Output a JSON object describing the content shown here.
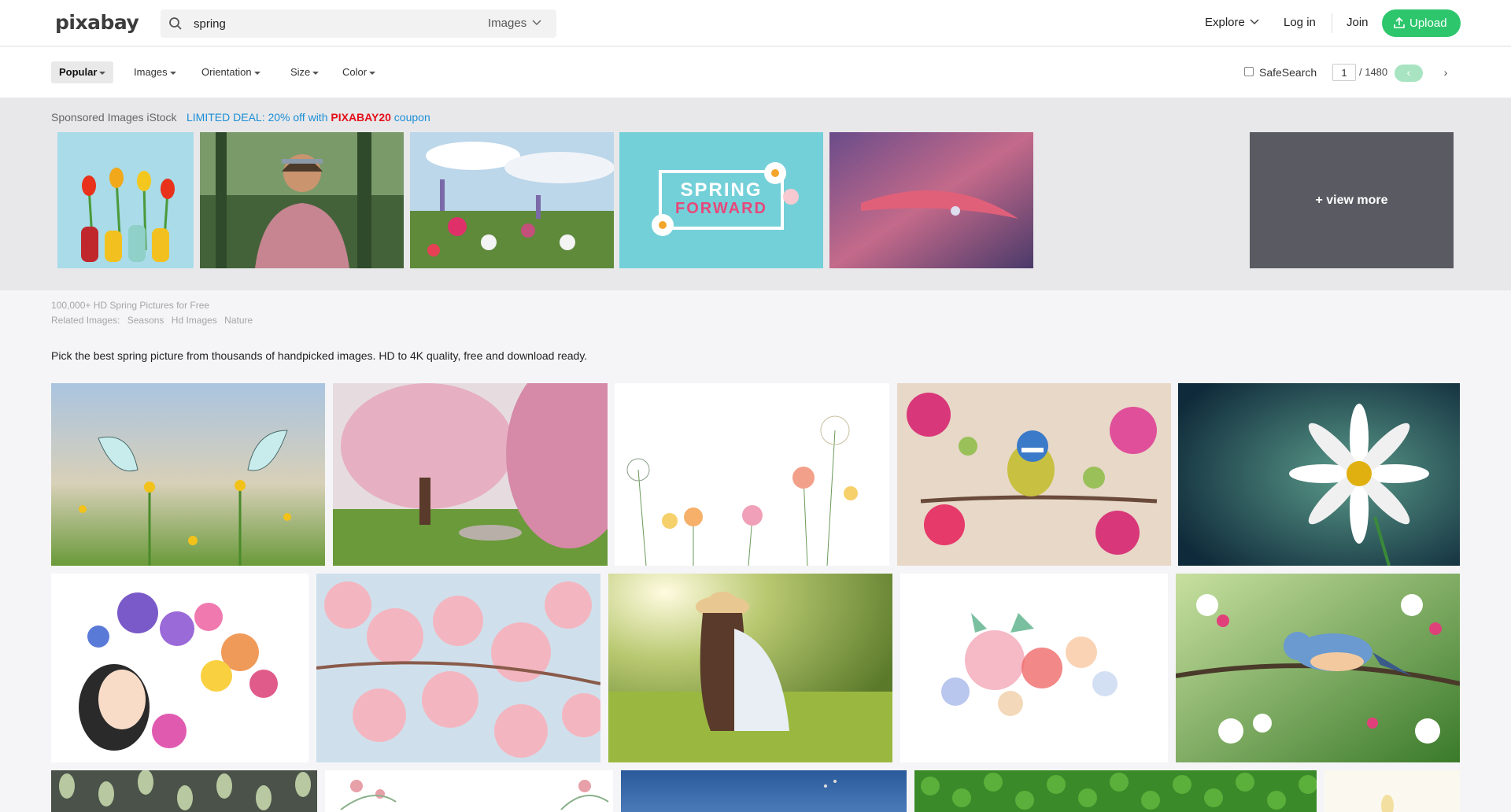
{
  "header": {
    "logo": "pixabay",
    "search_value": "spring",
    "search_type": "Images",
    "explore": "Explore",
    "login": "Log in",
    "join": "Join",
    "upload": "Upload"
  },
  "filters": {
    "popular": "Popular",
    "images": "Images",
    "orientation": "Orientation",
    "size": "Size",
    "color": "Color",
    "safesearch": "SafeSearch",
    "page": "1",
    "page_total": "/ 1480",
    "prev": "‹",
    "next": "›"
  },
  "sponsored": {
    "label": "Sponsored Images iStock",
    "deal_prefix": "LIMITED DEAL: 20% off with ",
    "deal_code": "PIXABAY20",
    "deal_suffix": " coupon",
    "view_more": "+ view more",
    "banner_line1": "SPRING",
    "banner_line2": "FORWARD"
  },
  "seo": {
    "title": "100,000+ HD Spring Pictures for Free",
    "related_label": "Related Images:",
    "related": [
      "Seasons",
      "Hd Images",
      "Nature"
    ],
    "description": "Pick the best spring picture from thousands of handpicked images. HD to 4K quality, free and download ready."
  }
}
